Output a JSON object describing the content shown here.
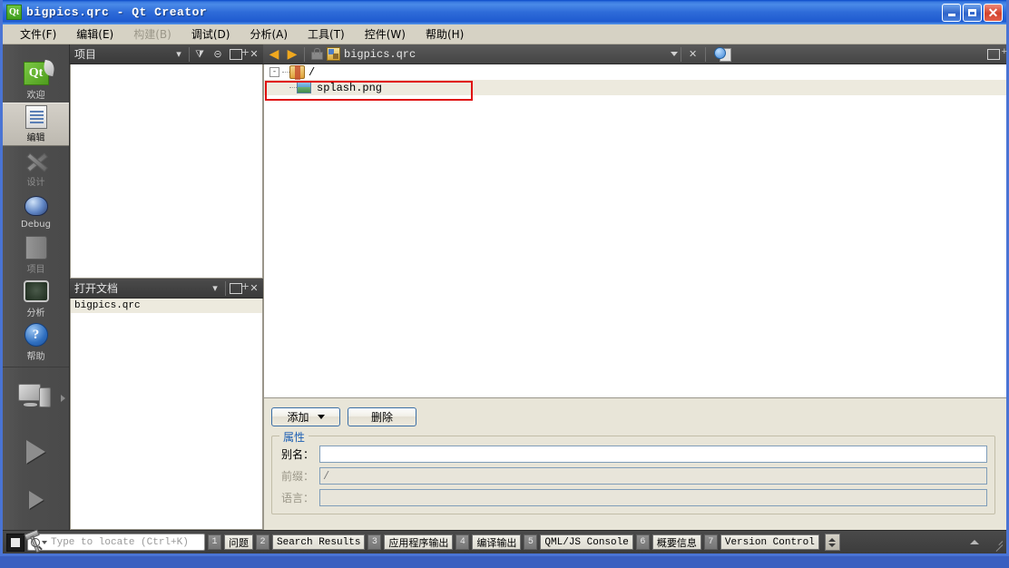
{
  "window": {
    "title": "bigpics.qrc - Qt Creator",
    "app_icon": "qt-logo-icon",
    "minimize_label": "Minimize",
    "maximize_label": "Maximize",
    "close_label": "Close"
  },
  "menubar": {
    "items": [
      {
        "label": "文件(F)",
        "disabled": false
      },
      {
        "label": "编辑(E)",
        "disabled": false
      },
      {
        "label": "构建(B)",
        "disabled": true
      },
      {
        "label": "调试(D)",
        "disabled": false
      },
      {
        "label": "分析(A)",
        "disabled": false
      },
      {
        "label": "工具(T)",
        "disabled": false
      },
      {
        "label": "控件(W)",
        "disabled": false
      },
      {
        "label": "帮助(H)",
        "disabled": false
      }
    ]
  },
  "modebar": {
    "modes": [
      {
        "label": "欢迎",
        "icon": "qt-welcome-icon",
        "active": false,
        "dim": false
      },
      {
        "label": "编辑",
        "icon": "document-edit-icon",
        "active": true,
        "dim": false
      },
      {
        "label": "设计",
        "icon": "design-tools-icon",
        "active": false,
        "dim": true
      },
      {
        "label": "Debug",
        "icon": "bug-icon",
        "active": false,
        "dim": false
      },
      {
        "label": "项目",
        "icon": "projects-folder-icon",
        "active": false,
        "dim": true
      },
      {
        "label": "分析",
        "icon": "analyzer-monitor-icon",
        "active": false,
        "dim": false
      },
      {
        "label": "帮助",
        "icon": "help-question-icon",
        "active": false,
        "dim": false
      }
    ],
    "actions": [
      {
        "name": "kit-selector",
        "icon": "computer-kit-icon"
      },
      {
        "name": "run-button",
        "icon": "play-triangle-icon"
      },
      {
        "name": "debug-button",
        "icon": "play-bug-icon"
      },
      {
        "name": "build-button",
        "icon": "hammer-icon"
      }
    ]
  },
  "project_panel": {
    "title": "项目",
    "filter_icon": "filter-icon",
    "sync_icon": "link-sync-icon",
    "split_icon": "split-add-icon",
    "close_icon": "close-icon",
    "items": []
  },
  "open_documents_panel": {
    "title": "打开文档",
    "split_icon": "split-add-icon",
    "close_icon": "close-icon",
    "documents": [
      {
        "name": "bigpics.qrc",
        "selected": true
      }
    ]
  },
  "editor_toolbar": {
    "back_icon": "arrow-back-icon",
    "forward_icon": "arrow-forward-icon",
    "lock_icon": "lock-icon",
    "file_icon": "qrc-file-icon",
    "filename": "bigpics.qrc",
    "dropdown_icon": "chevron-down-icon",
    "close_icon": "close-icon",
    "preview_icon": "preview-magnifier-icon",
    "split_icon": "split-add-icon"
  },
  "resource_tree": {
    "root": {
      "label": "/",
      "icon": "resource-prefix-icon",
      "expanded": true,
      "expander_glyph": "-"
    },
    "children": [
      {
        "label": "splash.png",
        "icon": "image-file-icon",
        "selected": true,
        "annotated": true
      }
    ]
  },
  "form": {
    "add_button": "添加",
    "add_has_dropdown": true,
    "remove_button": "删除",
    "group_title": "属性",
    "fields": [
      {
        "label": "别名：",
        "value": "",
        "placeholder": "",
        "disabled": false
      },
      {
        "label": "前缀：",
        "value": "/",
        "placeholder": "",
        "disabled": true
      },
      {
        "label": "语言：",
        "value": "",
        "placeholder": "",
        "disabled": true
      }
    ]
  },
  "statusbar": {
    "stop_icon": "stop-square-icon",
    "locator": {
      "icon": "search-icon",
      "placeholder": "Type to locate (Ctrl+K)",
      "value": ""
    },
    "panes": [
      {
        "num": "1",
        "label": "问题",
        "mono": false
      },
      {
        "num": "2",
        "label": "Search Results",
        "mono": true
      },
      {
        "num": "3",
        "label": "应用程序输出",
        "mono": false
      },
      {
        "num": "4",
        "label": "编译输出",
        "mono": false
      },
      {
        "num": "5",
        "label": "QML/JS Console",
        "mono": true
      },
      {
        "num": "6",
        "label": "概要信息",
        "mono": false
      },
      {
        "num": "7",
        "label": "Version Control",
        "mono": true
      }
    ],
    "spinner_icon": "up-down-spinner-icon",
    "toggle_icon": "collapse-arrow-icon",
    "resize_grip": "resize-grip-icon"
  },
  "colors": {
    "title_blue": "#2e6bd8",
    "chrome_gray": "#4a4a4a",
    "panel_beige": "#d6d2c4",
    "annotation_red": "#e01010",
    "selection_cream": "#edeade",
    "accent_orange": "#f0a81e",
    "link_blue": "#1c5fb4"
  }
}
